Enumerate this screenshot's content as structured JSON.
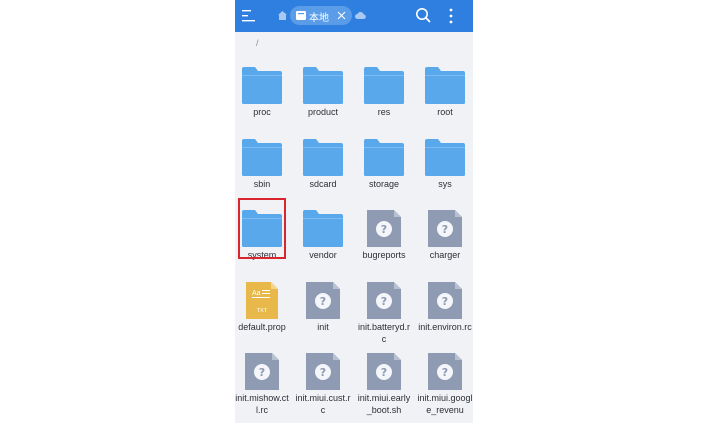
{
  "header": {
    "tab_label": "本地",
    "icons": [
      "menu-icon",
      "home-icon",
      "storage-icon",
      "close-icon",
      "cloud-icon",
      "search-icon",
      "more-vertical-icon"
    ]
  },
  "breadcrumb": "/",
  "colors": {
    "header": "#2f7fe0",
    "folder": "#5aa8ec",
    "unknown_file": "#8e9bb3",
    "txt_file": "#e8b94a",
    "selection": "#d9262e"
  },
  "items": [
    {
      "name": "proc",
      "type": "folder"
    },
    {
      "name": "product",
      "type": "folder"
    },
    {
      "name": "res",
      "type": "folder"
    },
    {
      "name": "root",
      "type": "folder"
    },
    {
      "name": "sbin",
      "type": "folder"
    },
    {
      "name": "sdcard",
      "type": "folder"
    },
    {
      "name": "storage",
      "type": "folder"
    },
    {
      "name": "sys",
      "type": "folder"
    },
    {
      "name": "system",
      "type": "folder",
      "selected": true
    },
    {
      "name": "vendor",
      "type": "folder"
    },
    {
      "name": "bugreports",
      "type": "unknown"
    },
    {
      "name": "charger",
      "type": "unknown"
    },
    {
      "name": "default.prop",
      "type": "txt",
      "badge_top": "Aa",
      "badge_bottom": "TXT"
    },
    {
      "name": "init",
      "type": "unknown"
    },
    {
      "name": "init.batteryd.rc",
      "type": "unknown"
    },
    {
      "name": "init.environ.rc",
      "type": "unknown"
    },
    {
      "name": "init.mishow.ctl.rc",
      "type": "unknown"
    },
    {
      "name": "init.miui.cust.rc",
      "type": "unknown"
    },
    {
      "name": "init.miui.early_boot.sh",
      "type": "unknown"
    },
    {
      "name": "init.miui.google_revenu",
      "type": "unknown"
    }
  ]
}
